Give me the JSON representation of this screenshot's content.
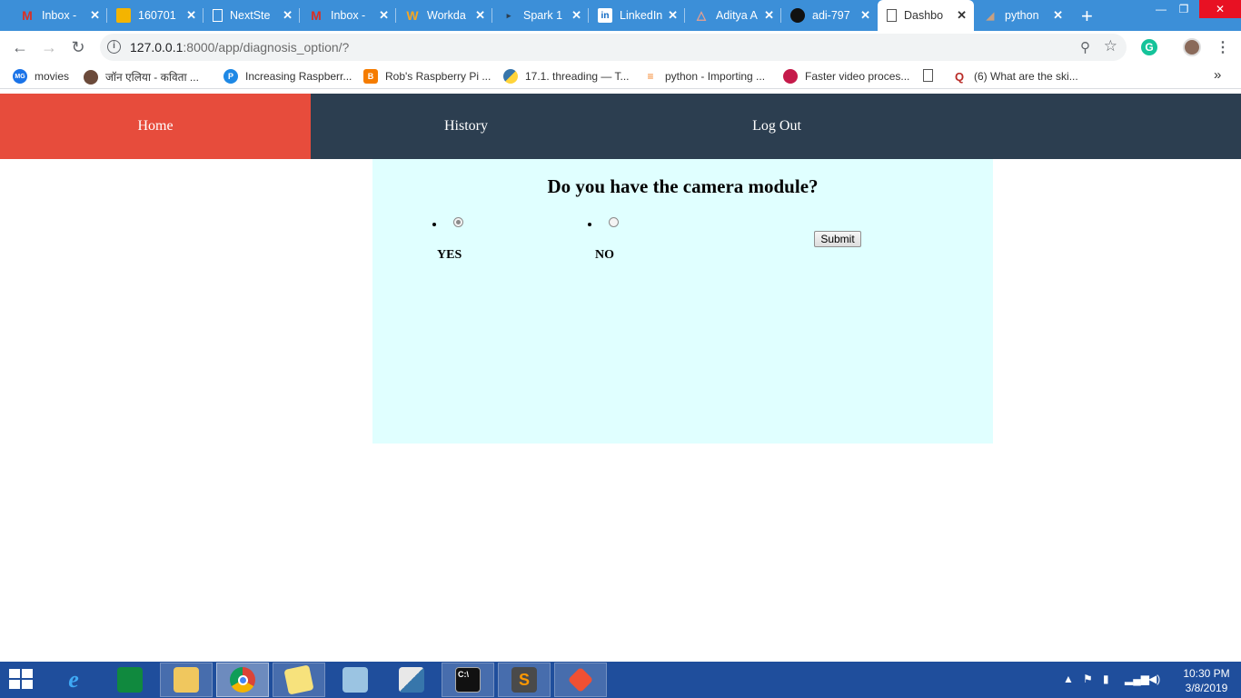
{
  "browser": {
    "tabs": [
      {
        "title": "Inbox -",
        "icon": "gmail-icon"
      },
      {
        "title": "160701",
        "icon": "slides-icon"
      },
      {
        "title": "NextSte",
        "icon": "page-icon"
      },
      {
        "title": "Inbox -",
        "icon": "gmail-icon"
      },
      {
        "title": "Workda",
        "icon": "workday-icon"
      },
      {
        "title": "Spark 1",
        "icon": "spark-icon"
      },
      {
        "title": "LinkedIn",
        "icon": "linkedin-icon"
      },
      {
        "title": "Aditya A",
        "icon": "drive-icon"
      },
      {
        "title": "adi-797",
        "icon": "github-icon"
      },
      {
        "title": "Dashbo",
        "icon": "page-icon",
        "active": true
      },
      {
        "title": "python",
        "icon": "python-icon"
      }
    ],
    "url_host": "127.0.0.1",
    "url_path": ":8000/app/diagnosis_option/?",
    "bookmarks": [
      {
        "label": "movies",
        "icon": "mg-icon"
      },
      {
        "label": "जॉन एलिया - कविता ...",
        "icon": "avatar-icon"
      },
      {
        "label": "Increasing Raspberr...",
        "icon": "pi-icon"
      },
      {
        "label": "Rob's Raspberry Pi ...",
        "icon": "blogger-icon"
      },
      {
        "label": "17.1. threading — T...",
        "icon": "python-icon"
      },
      {
        "label": "python - Importing ...",
        "icon": "stackoverflow-icon"
      },
      {
        "label": "Faster video proces...",
        "icon": "raspberry-icon"
      },
      {
        "label": "",
        "icon": "page-icon"
      },
      {
        "label": "(6) What are the ski...",
        "icon": "quora-icon"
      }
    ]
  },
  "nav": {
    "home": "Home",
    "history": "History",
    "logout": "Log Out"
  },
  "main": {
    "question": "Do you have the camera module?",
    "options": [
      {
        "label": "YES",
        "selected": true
      },
      {
        "label": "NO",
        "selected": false
      }
    ],
    "submit_label": "Submit"
  },
  "taskbar": {
    "time": "10:30 PM",
    "date": "3/8/2019"
  },
  "colors": {
    "nav_bg": "#2c3e50",
    "nav_active": "#e74c3c",
    "panel_bg": "#e0ffff",
    "tabstrip": "#3c8fd8",
    "taskbar": "#1f4e9c"
  }
}
